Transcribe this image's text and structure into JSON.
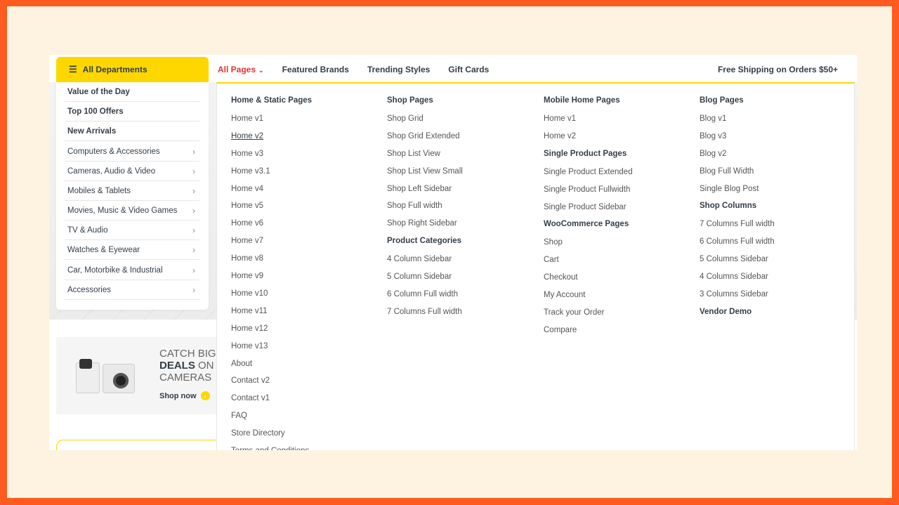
{
  "departments_button": {
    "label": "All Departments",
    "icon": "list-icon"
  },
  "nav": {
    "items": [
      "All Pages",
      "Featured Brands",
      "Trending Styles",
      "Gift Cards"
    ],
    "shipping": "Free Shipping on Orders $50+"
  },
  "sidebar": {
    "items": [
      "Value of the Day",
      "Top 100 Offers",
      "New Arrivals",
      "Computers & Accessories",
      "Cameras, Audio & Video",
      "Mobiles & Tablets",
      "Movies, Music & Video Games",
      "TV & Audio",
      "Watches & Eyewear",
      "Car, Motorbike & Industrial",
      "Accessories"
    ]
  },
  "promo": {
    "line1": "CATCH BIG",
    "line2_bold": "DEALS",
    "line2_rest": " ON T",
    "line3": "CAMERAS",
    "cta": "Shop now"
  },
  "mega": {
    "col1": [
      "Home & Static Pages",
      "Home v1",
      "Home v2",
      "Home v3",
      "Home v3.1",
      "Home v4",
      "Home v5",
      "Home v6",
      "Home v7",
      "Home v8",
      "Home v9",
      "Home v10",
      "Home v11",
      "Home v12",
      "Home v13",
      "About",
      "Contact v2",
      "Contact v1",
      "FAQ",
      "Store Directory",
      "Terms and Conditions"
    ],
    "col2": [
      "Shop Pages",
      "Shop Grid",
      "Shop Grid Extended",
      "Shop List View",
      "Shop List View Small",
      "Shop Left Sidebar",
      "Shop Full width",
      "Shop Right Sidebar",
      "Product Categories",
      "4 Column Sidebar",
      "5 Column Sidebar",
      "6 Column Full width",
      "7 Columns Full width"
    ],
    "col3": [
      "Mobile Home Pages",
      "Home v1",
      "Home v2",
      "Single Product Pages",
      "Single Product Extended",
      "Single Product Fullwidth",
      "Single Product Sidebar",
      "WooCommerce Pages",
      "Shop",
      "Cart",
      "Checkout",
      "My Account",
      "Track your Order",
      "Compare"
    ],
    "col4": [
      "Blog Pages",
      "Blog v1",
      "Blog v3",
      "Blog v2",
      "Blog Full Width",
      "Single Blog Post",
      "Shop Columns",
      "7 Columns Full width",
      "6 Columns Full width",
      "5 Columns Sidebar",
      "4 Columns Sidebar",
      "3 Columns Sidebar",
      "Vendor Demo"
    ]
  }
}
